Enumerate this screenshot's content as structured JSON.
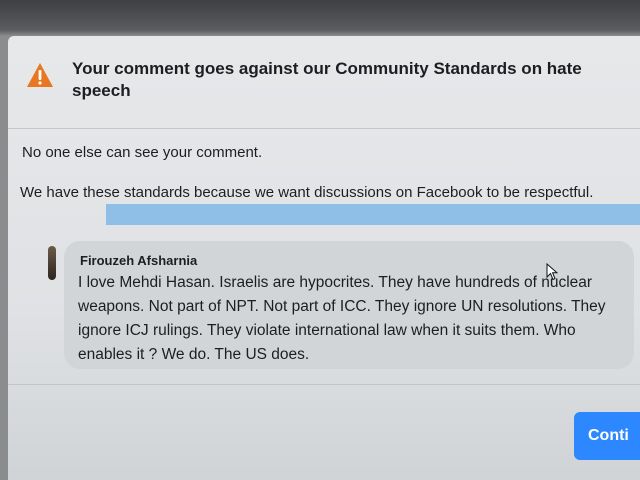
{
  "colors": {
    "accent": "#2d88ff",
    "warning": "#e8771f",
    "selection": "#8fbfe6"
  },
  "dialog": {
    "title": "Your comment goes against our Community Standards on hate speech",
    "warning_icon": "warning-triangle-icon",
    "private_notice": "No one else can see your comment.",
    "reason_text": "We have these standards because we want discussions on Facebook to be respectful.",
    "comment": {
      "author": "Firouzeh Afsharnia",
      "text": "I love Mehdi Hasan. Israelis are hypocrites. They have hundreds of nuclear weapons. Not part of NPT. Not part of ICC. They ignore UN resolutions. They ignore ICJ rulings. They violate international law when it suits them. Who enables it ? We do. The US does."
    },
    "continue_label": "Conti"
  }
}
